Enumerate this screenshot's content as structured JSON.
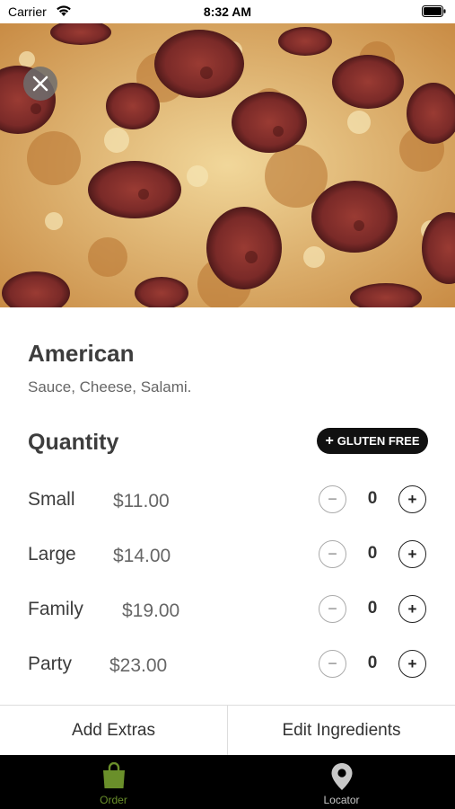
{
  "status_bar": {
    "carrier": "Carrier",
    "time": "8:32 AM"
  },
  "product": {
    "name": "American",
    "description": "Sauce, Cheese, Salami."
  },
  "quantity": {
    "title": "Quantity",
    "gluten_free_label": "GLUTEN FREE",
    "sizes": [
      {
        "label": "Small",
        "price": "$11.00",
        "count": "0"
      },
      {
        "label": "Large",
        "price": "$14.00",
        "count": "0"
      },
      {
        "label": "Family",
        "price": "$19.00",
        "count": "0"
      },
      {
        "label": "Party",
        "price": "$23.00",
        "count": "0"
      }
    ]
  },
  "actions": {
    "add_extras": "Add Extras",
    "edit_ingredients": "Edit Ingredients"
  },
  "tabs": [
    {
      "label": "Order",
      "icon": "shopping-bag-icon",
      "active": true,
      "color": "#6a8f2a"
    },
    {
      "label": "Locator",
      "icon": "location-pin-icon",
      "active": false,
      "color": "#c8c8c8"
    }
  ],
  "colors": {
    "accent": "#6a8f2a",
    "tab_bar": "#000000",
    "gluten_button": "#111111"
  },
  "icons": {
    "close": "close-icon",
    "wifi": "wifi-icon",
    "battery": "battery-icon",
    "minus": "minus-icon",
    "plus": "plus-icon"
  }
}
